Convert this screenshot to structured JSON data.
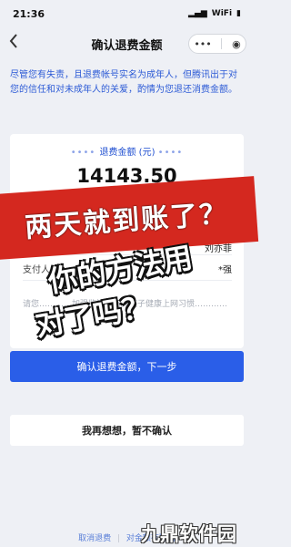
{
  "status_bar": {
    "time": "21:36",
    "signal": "▂▄▆",
    "wifi": "WiFi",
    "battery": "▮"
  },
  "nav": {
    "back_icon": "chevron-left-icon",
    "title": "确认退费金额",
    "more": "•••",
    "close": "◉"
  },
  "notice": "尽管您有失责，且退费帐号实名为成年人，但腾讯出于对您的信任和对未成年人的关爱，酌情为您退还消费金额。",
  "card": {
    "amount_label": "退费金额 (元)",
    "amount": "14143.50",
    "payee_value": "刘亦菲",
    "payer_label": "支付人",
    "payer_value": "*强",
    "tip": "请您…………加强监管，培养孩子健康上网习惯…………"
  },
  "buttons": {
    "confirm": "确认退费金额，下一步",
    "rethink": "我再想想，暂不确认"
  },
  "footer": {
    "link1": "取消退费",
    "link2": "对金额有疑问"
  },
  "overlays": {
    "banner": "两天就到账了？",
    "line1": "你的方法用",
    "line2": "对了吗？"
  },
  "watermark": "九鼎软件园"
}
